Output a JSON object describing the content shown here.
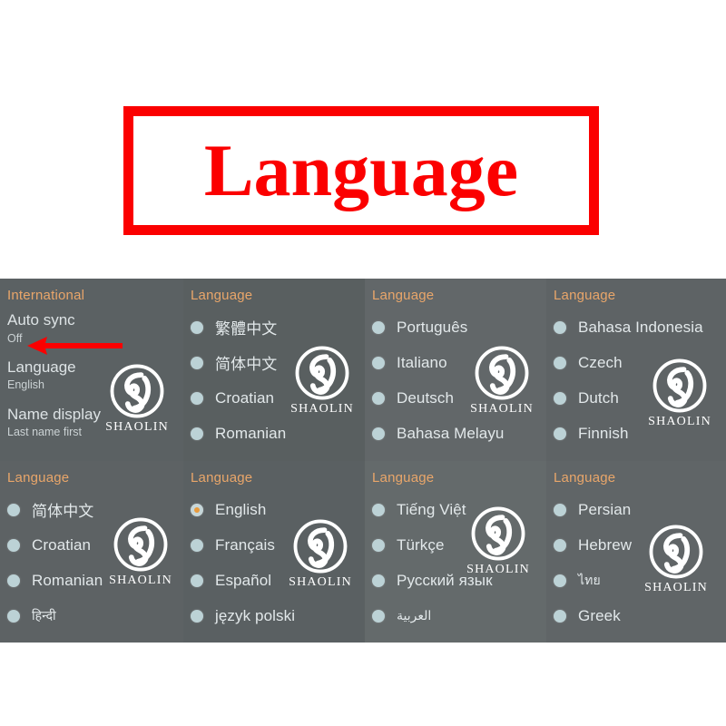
{
  "title_banner": {
    "text": "Language",
    "border_color": "#fb0000",
    "text_color": "#fb0000",
    "background": "#ffffff"
  },
  "annotation": {
    "arrow": "left-arrow",
    "color": "#fb0000",
    "points_at": "Off"
  },
  "brand": {
    "wordmark": "SHAOLIN",
    "logo": "shaolin-circle-monogram"
  },
  "panels": [
    {
      "header": "International",
      "type": "settings",
      "settings": [
        {
          "label": "Auto sync",
          "value": "Off"
        },
        {
          "label": "Language",
          "value": "English"
        },
        {
          "label": "Name display",
          "value": "Last name first"
        }
      ]
    },
    {
      "header": "Language",
      "type": "language-list",
      "options": [
        {
          "label": "繁體中文",
          "selected": false
        },
        {
          "label": "简体中文",
          "selected": false
        },
        {
          "label": "Croatian",
          "selected": false
        },
        {
          "label": "Romanian",
          "selected": false
        }
      ]
    },
    {
      "header": "Language",
      "type": "language-list",
      "options": [
        {
          "label": "Português",
          "selected": false
        },
        {
          "label": "Italiano",
          "selected": false
        },
        {
          "label": "Deutsch",
          "selected": false
        },
        {
          "label": "Bahasa Melayu",
          "selected": false
        }
      ]
    },
    {
      "header": "Language",
      "type": "language-list",
      "options": [
        {
          "label": "Bahasa Indonesia",
          "selected": false
        },
        {
          "label": "Czech",
          "selected": false
        },
        {
          "label": "Dutch",
          "selected": false
        },
        {
          "label": "Finnish",
          "selected": false
        }
      ]
    },
    {
      "header": "Language",
      "type": "language-list",
      "options": [
        {
          "label": "简体中文",
          "selected": false
        },
        {
          "label": "Croatian",
          "selected": false
        },
        {
          "label": "Romanian",
          "selected": false
        },
        {
          "label": "हिन्दी",
          "selected": false
        }
      ]
    },
    {
      "header": "Language",
      "type": "language-list",
      "options": [
        {
          "label": "English",
          "selected": true
        },
        {
          "label": "Français",
          "selected": false
        },
        {
          "label": "Español",
          "selected": false
        },
        {
          "label": "język polski",
          "selected": false
        }
      ]
    },
    {
      "header": "Language",
      "type": "language-list",
      "options": [
        {
          "label": "Tiếng Việt",
          "selected": false
        },
        {
          "label": "Türkçe",
          "selected": false
        },
        {
          "label": "Русский язык",
          "selected": false
        },
        {
          "label": "العربية",
          "selected": false
        }
      ]
    },
    {
      "header": "Language",
      "type": "language-list",
      "options": [
        {
          "label": "Persian",
          "selected": false
        },
        {
          "label": "Hebrew",
          "selected": false
        },
        {
          "label": "ไทย",
          "selected": false
        },
        {
          "label": "Greek",
          "selected": false
        }
      ]
    }
  ]
}
